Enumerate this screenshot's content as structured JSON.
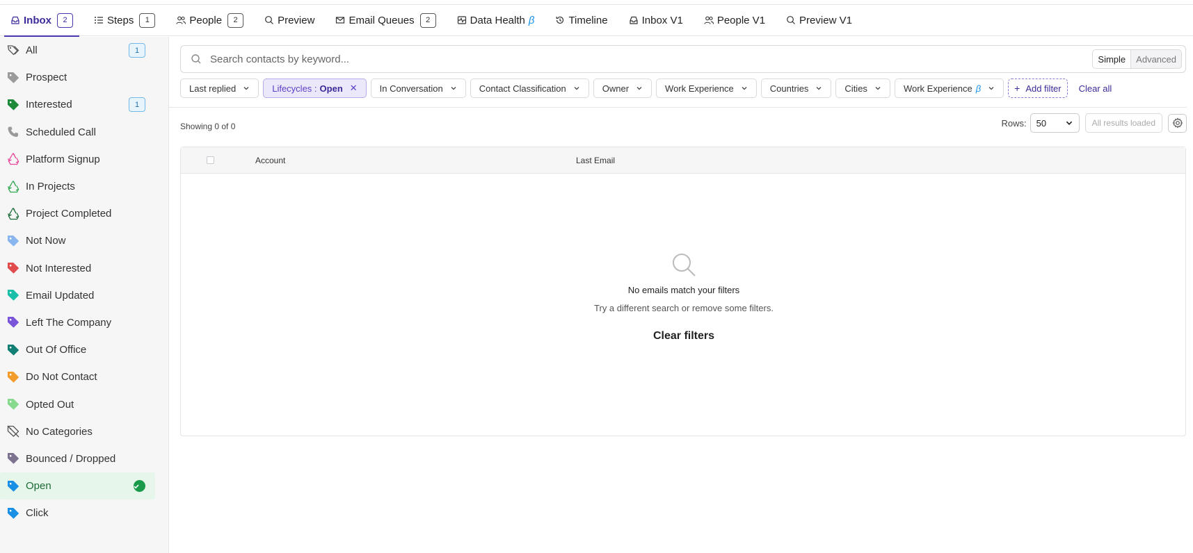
{
  "tabs": [
    {
      "label": "Inbox",
      "count": "2",
      "icon": "inbox-icon"
    },
    {
      "label": "Steps",
      "count": "1",
      "icon": "list-icon"
    },
    {
      "label": "People",
      "count": "2",
      "icon": "people-icon"
    },
    {
      "label": "Preview",
      "icon": "search-icon"
    },
    {
      "label": "Email Queues",
      "count": "2",
      "icon": "mail-icon"
    },
    {
      "label": "Data Health",
      "beta": "β",
      "icon": "health-icon"
    },
    {
      "label": "Timeline",
      "icon": "history-icon"
    },
    {
      "label": "Inbox V1",
      "icon": "inbox-icon"
    },
    {
      "label": "People V1",
      "icon": "people-icon"
    },
    {
      "label": "Preview V1",
      "icon": "search-icon"
    }
  ],
  "sidebar": {
    "items": [
      {
        "label": "All",
        "count": "1",
        "color": "#555555",
        "icon": "tags-icon"
      },
      {
        "label": "Prospect",
        "color": "#9a9a9a",
        "icon": "tag-icon"
      },
      {
        "label": "Interested",
        "count": "1",
        "color": "#1d8a3a",
        "icon": "tag-icon"
      },
      {
        "label": "Scheduled Call",
        "color": "#9a9a9a",
        "icon": "phone-icon"
      },
      {
        "label": "Platform Signup",
        "color": "#e8479a",
        "icon": "recycle-icon"
      },
      {
        "label": "In Projects",
        "color": "#2fa84f",
        "icon": "recycle-icon"
      },
      {
        "label": "Project Completed",
        "color": "#1c6b37",
        "icon": "recycle-icon"
      },
      {
        "label": "Not Now",
        "color": "#8ab6ef",
        "icon": "tag-icon"
      },
      {
        "label": "Not Interested",
        "color": "#e24b4b",
        "icon": "tag-icon"
      },
      {
        "label": "Email Updated",
        "color": "#19bfa8",
        "icon": "tag-icon"
      },
      {
        "label": "Left The Company",
        "color": "#7a55d9",
        "icon": "tag-icon"
      },
      {
        "label": "Out Of Office",
        "color": "#117f74",
        "icon": "tag-icon"
      },
      {
        "label": "Do Not Contact",
        "color": "#f39b2b",
        "icon": "tag-icon"
      },
      {
        "label": "Opted Out",
        "color": "#86d98d",
        "icon": "tag-icon"
      },
      {
        "label": "No Categories",
        "color": "#555555",
        "icon": "tag-off-icon"
      },
      {
        "label": "Bounced / Dropped",
        "color": "#7d7390",
        "icon": "tag-icon"
      },
      {
        "label": "Open",
        "color": "#1a8fe6",
        "icon": "tag-icon",
        "active": true
      },
      {
        "label": "Click",
        "color": "#1a8fe6",
        "icon": "tag-icon"
      }
    ]
  },
  "search": {
    "placeholder": "Search contacts by keyword..."
  },
  "mode": {
    "simple": "Simple",
    "advanced": "Advanced"
  },
  "filters": {
    "last_replied": "Last replied",
    "lifecycle_key": "Lifecycles :",
    "lifecycle_value": "Open",
    "in_conversation": "In Conversation",
    "contact_classification": "Contact Classification",
    "owner": "Owner",
    "work_experience": "Work Experience",
    "countries": "Countries",
    "cities": "Cities",
    "work_experience_beta": "Work Experience",
    "beta": "β",
    "add_filter": "Add filter",
    "clear_all": "Clear all"
  },
  "results": {
    "showing": "Showing 0 of 0",
    "rows_label": "Rows:",
    "rows_value": "50",
    "loaded": "All results loaded"
  },
  "table": {
    "col_account": "Account",
    "col_last_email": "Last Email",
    "empty_title": "No emails match your filters",
    "empty_hint": "Try a different search or remove some filters.",
    "clear_filters": "Clear filters"
  },
  "colors": {
    "accent": "#4a35b0",
    "active_bg": "#e6f6ea",
    "active_text": "#1c6b37"
  }
}
